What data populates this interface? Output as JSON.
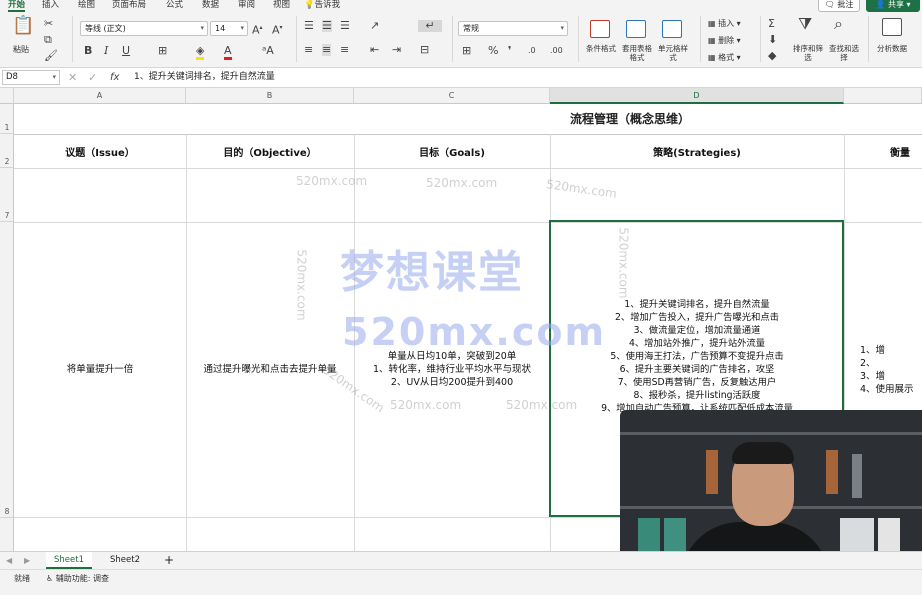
{
  "tabs": [
    "开始",
    "插入",
    "绘图",
    "页面布局",
    "公式",
    "数据",
    "审阅",
    "视图",
    "告诉我"
  ],
  "comment_label": "批注",
  "share_label": "共享",
  "ribbon": {
    "paste_label": "粘贴",
    "font_name": "等线 (正文)",
    "font_size": "14",
    "number_format": "常规",
    "conditional_format": "条件格式",
    "table_format": "套用表格格式",
    "cell_style": "单元格样式",
    "insert": "插入",
    "delete": "删除",
    "format": "格式",
    "sort_filter": "排序和筛选",
    "find_select": "查找和选择",
    "analyze": "分析数据"
  },
  "formula_bar": {
    "name_box": "D8",
    "fx": "fx",
    "content": "1、提升关键词排名，提升自然流量"
  },
  "columns": [
    "A",
    "B",
    "C",
    "D"
  ],
  "rows": [
    "1",
    "2",
    "7",
    "8"
  ],
  "sheet": {
    "title": "流程管理（概念思维）",
    "headers": [
      "议题（Issue）",
      "目的（Objective）",
      "目标（Goals)",
      "策略(Strategies)",
      "衡量"
    ],
    "row8": {
      "a": "将单量提升一倍",
      "b": "通过提升曝光和点击去提升单量",
      "c": "单量从日均10单，突破到20单\n1、转化率，维持行业平均水平与现状\n2、UV从日均200提升到400",
      "d": "1、提升关键词排名，提升自然流量\n2、增加广告投入，提升广告曝光和点击\n3、做流量定位，增加流量通道\n4、增加站外推广，提升站外流量\n5、使用海王打法，广告预算不变提升点击\n6、提升主要关键词的广告排名，攻坚\n7、使用SD再营销广告，反复触达用户\n8、报秒杀，提升listing活跃度\n9、增加自动广告预算，让系统匹配低成本流量",
      "e": "1、增\n2、\n3、增\n4、使用展示"
    }
  },
  "watermark": {
    "big_cn": "梦想课堂",
    "big_en": "520mx.com",
    "small": "520mx.com"
  },
  "sheet_tabs": [
    "Sheet1",
    "Sheet2"
  ],
  "add_sheet": "+",
  "status": {
    "ready": "就绪",
    "accessibility": "辅助功能: 调查"
  }
}
